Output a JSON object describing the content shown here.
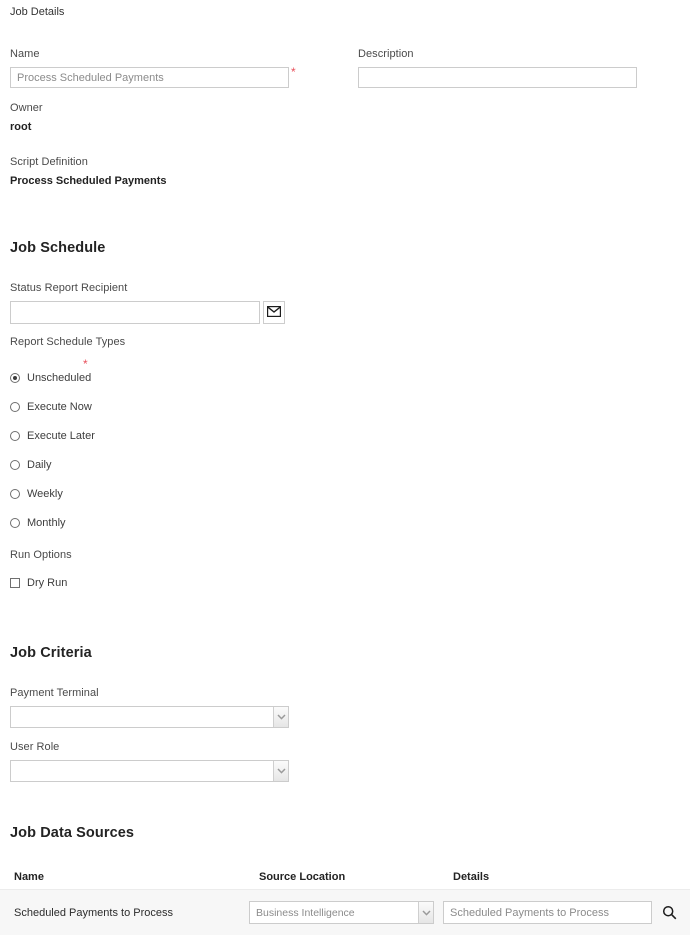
{
  "sections": {
    "job_details": {
      "title": "Job Details",
      "name_label": "Name",
      "name_value": "Process Scheduled Payments",
      "name_required": "*",
      "description_label": "Description",
      "description_value": "",
      "description_placeholder": "",
      "owner_label": "Owner",
      "owner_value": "root",
      "script_definition_label": "Script Definition",
      "script_definition_value": "Process Scheduled Payments"
    },
    "job_schedule": {
      "title": "Job Schedule",
      "status_report_recipient_label": "Status Report Recipient",
      "status_report_recipient_value": "",
      "email_icon": "envelope-icon",
      "report_schedule_types_label": "Report Schedule Types",
      "required_marker": "*",
      "schedule_options": [
        {
          "label": "Unscheduled",
          "selected": true
        },
        {
          "label": "Execute Now",
          "selected": false
        },
        {
          "label": "Execute Later",
          "selected": false
        },
        {
          "label": "Daily",
          "selected": false
        },
        {
          "label": "Weekly",
          "selected": false
        },
        {
          "label": "Monthly",
          "selected": false
        }
      ],
      "run_options_label": "Run Options",
      "run_options": [
        {
          "label": "Dry Run",
          "checked": false
        }
      ]
    },
    "job_criteria": {
      "title": "Job Criteria",
      "payment_terminal_label": "Payment Terminal",
      "payment_terminal_value": "",
      "user_role_label": "User Role",
      "user_role_value": ""
    },
    "job_data_sources": {
      "title": "Job Data Sources",
      "columns": [
        "Name",
        "Source Location",
        "Details"
      ],
      "rows": [
        {
          "name": "Scheduled Payments to Process",
          "source_location": "Business Intelligence",
          "details": "Scheduled Payments to Process",
          "details_icon": "search-icon"
        }
      ]
    }
  },
  "colors": {
    "heading": "#232323",
    "label": "#4a4a4a",
    "required": "#e8505b",
    "input_border": "#cccccc",
    "row_background": "#f7f7f7"
  }
}
